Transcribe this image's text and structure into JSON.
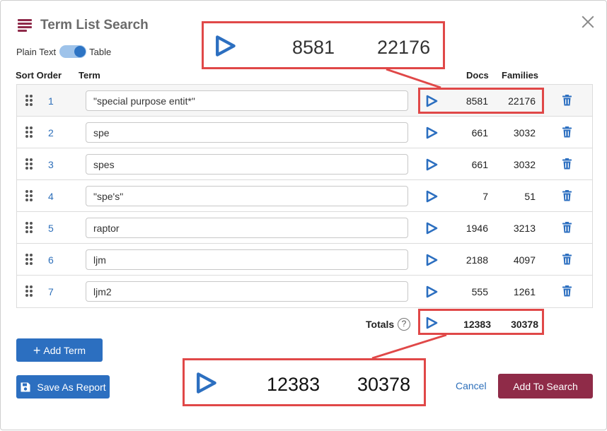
{
  "dialog": {
    "title": "Term List Search",
    "toggle": {
      "left_label": "Plain Text",
      "right_label": "Table",
      "state": "Table"
    }
  },
  "columns": {
    "sort_order": "Sort Order",
    "term": "Term",
    "docs": "Docs",
    "families": "Families"
  },
  "rows": [
    {
      "order": "1",
      "term": "\"special purpose entit*\"",
      "docs": "8581",
      "families": "22176"
    },
    {
      "order": "2",
      "term": "spe",
      "docs": "661",
      "families": "3032"
    },
    {
      "order": "3",
      "term": "spes",
      "docs": "661",
      "families": "3032"
    },
    {
      "order": "4",
      "term": "\"spe's\"",
      "docs": "7",
      "families": "51"
    },
    {
      "order": "5",
      "term": "raptor",
      "docs": "1946",
      "families": "3213"
    },
    {
      "order": "6",
      "term": "ljm",
      "docs": "2188",
      "families": "4097"
    },
    {
      "order": "7",
      "term": "ljm2",
      "docs": "555",
      "families": "1261"
    }
  ],
  "totals": {
    "label": "Totals",
    "help_glyph": "?",
    "docs": "12383",
    "families": "30378"
  },
  "buttons": {
    "add_term": "Add Term",
    "add_term_glyph": "+",
    "save_report": "Save As Report",
    "cancel": "Cancel",
    "add_to_search": "Add To Search"
  },
  "callouts": {
    "top": {
      "docs": "8581",
      "families": "22176"
    },
    "bottom": {
      "docs": "12383",
      "families": "30378"
    }
  },
  "colors": {
    "accent_blue": "#2c6fc0",
    "brand_wine": "#8f2b48",
    "highlight_red": "#e04848"
  },
  "icons": [
    "menu-icon",
    "close-icon",
    "drag-handle-icon",
    "play-icon",
    "trash-icon",
    "help-icon",
    "plus-icon",
    "save-icon"
  ]
}
